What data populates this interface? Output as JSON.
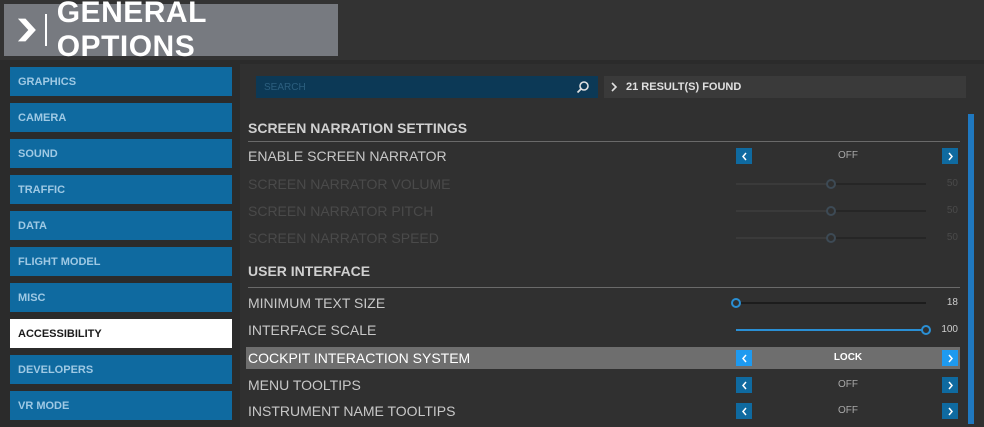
{
  "header": {
    "title": "GENERAL OPTIONS",
    "icon": "chevron-right-icon"
  },
  "sidebar": {
    "items": [
      {
        "label": "GRAPHICS",
        "active": false
      },
      {
        "label": "CAMERA",
        "active": false
      },
      {
        "label": "SOUND",
        "active": false
      },
      {
        "label": "TRAFFIC",
        "active": false
      },
      {
        "label": "DATA",
        "active": false
      },
      {
        "label": "FLIGHT MODEL",
        "active": false
      },
      {
        "label": "MISC",
        "active": false
      },
      {
        "label": "ACCESSIBILITY",
        "active": true
      },
      {
        "label": "DEVELOPERS",
        "active": false
      },
      {
        "label": "VR MODE",
        "active": false
      }
    ]
  },
  "search": {
    "placeholder": "SEARCH",
    "value": "",
    "results": "21 RESULT(S) FOUND"
  },
  "sections": [
    {
      "title": "SCREEN NARRATION SETTINGS",
      "rows": [
        {
          "label": "ENABLE SCREEN NARRATOR",
          "control": "stepper",
          "value": "OFF",
          "disabled": false
        },
        {
          "label": "SCREEN NARRATOR VOLUME",
          "control": "slider",
          "value": "50",
          "fraction": 0.5,
          "disabled": true
        },
        {
          "label": "SCREEN NARRATOR PITCH",
          "control": "slider",
          "value": "50",
          "fraction": 0.5,
          "disabled": true
        },
        {
          "label": "SCREEN NARRATOR SPEED",
          "control": "slider",
          "value": "50",
          "fraction": 0.5,
          "disabled": true
        }
      ]
    },
    {
      "title": "USER INTERFACE",
      "rows": [
        {
          "label": "MINIMUM TEXT SIZE",
          "control": "slider",
          "value": "18",
          "fraction": 0.0,
          "disabled": false
        },
        {
          "label": "INTERFACE SCALE",
          "control": "slider",
          "value": "100",
          "fraction": 1.0,
          "disabled": false
        },
        {
          "label": "COCKPIT INTERACTION SYSTEM",
          "control": "stepper",
          "value": "LOCK",
          "disabled": false,
          "highlighted": true
        },
        {
          "label": "MENU TOOLTIPS",
          "control": "stepper",
          "value": "OFF",
          "disabled": false
        },
        {
          "label": "INSTRUMENT NAME TOOLTIPS",
          "control": "stepper",
          "value": "OFF",
          "disabled": false
        }
      ]
    }
  ],
  "colors": {
    "accent": "#0f6aa0",
    "accent_bright": "#1e9af0",
    "active_tab": "#ffffff",
    "highlight_row": "#6e6e6e",
    "panel": "#303030"
  }
}
